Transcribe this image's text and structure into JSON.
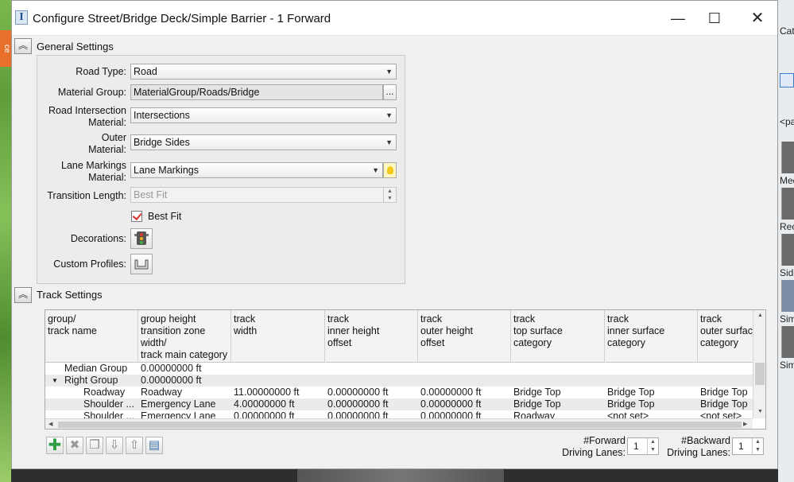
{
  "window": {
    "title": "Configure Street/Bridge Deck/Simple Barrier - 1 Forward",
    "app_icon_glyph": "I",
    "minimize_glyph": "—",
    "maximize_glyph": "☐",
    "close_glyph": "✕"
  },
  "background": {
    "right_fragments": [
      "Cata",
      "<pa",
      "Med",
      "Rec",
      "Side",
      "Sim",
      "Sim"
    ],
    "left_fragment": "ce"
  },
  "general_settings": {
    "label": "General Settings",
    "road_type": {
      "label": "Road Type:",
      "value": "Road"
    },
    "material_group": {
      "label": "Material Group:",
      "value": "MaterialGroup/Roads/Bridge",
      "browse_label": "..."
    },
    "road_intersection": {
      "label_line1": "Road Intersection",
      "label_line2": "Material:",
      "value": "Intersections"
    },
    "outer_material": {
      "label_line1": "Outer",
      "label_line2": "Material:",
      "value": "Bridge Sides"
    },
    "lane_markings": {
      "label_line1": "Lane Markings",
      "label_line2": "Material:",
      "value": "Lane Markings"
    },
    "transition_length": {
      "label": "Transition Length:",
      "value": "Best Fit"
    },
    "best_fit": {
      "label": "Best Fit",
      "checked": true
    },
    "decorations": {
      "label": "Decorations:",
      "icon": "traffic-light-icon"
    },
    "custom_profiles": {
      "label": "Custom Profiles:",
      "icon": "profile-shape-icon"
    }
  },
  "track_settings": {
    "label": "Track Settings",
    "columns": [
      "group/\ntrack name",
      "group height\ntransition zone\nwidth/\ntrack main category",
      "track\nwidth",
      "track\ninner height\noffset",
      "track\nouter height\noffset",
      "track\ntop surface\ncategory",
      "track\ninner surface\ncategory",
      "track\nouter surfac\ncategory"
    ],
    "rows": [
      {
        "expander": "",
        "cells": [
          "Median Group",
          "0.00000000 ft",
          "",
          "",
          "",
          "",
          "",
          ""
        ]
      },
      {
        "expander": "▼",
        "cells": [
          "Right Group",
          "0.00000000 ft",
          "",
          "",
          "",
          "",
          "",
          ""
        ]
      },
      {
        "expander": "",
        "cells": [
          "Roadway",
          "Roadway",
          "11.00000000 ft",
          "0.00000000 ft",
          "0.00000000 ft",
          "Bridge Top",
          "Bridge Top",
          "Bridge Top"
        ]
      },
      {
        "expander": "",
        "cells": [
          "Shoulder ...",
          "Emergency Lane",
          "4.00000000 ft",
          "0.00000000 ft",
          "0.00000000 ft",
          "Bridge Top",
          "Bridge Top",
          "Bridge Top"
        ]
      },
      {
        "expander": "",
        "cells": [
          "Shoulder ...",
          "Emergency Lane",
          "0.00000000 ft",
          "0.00000000 ft",
          "0.00000000 ft",
          "Roadway",
          "<not set>",
          "<not set>"
        ]
      }
    ],
    "toolbar": {
      "add": "add-icon",
      "remove": "remove-icon",
      "copy": "copy-icon",
      "move_down": "move-down-icon",
      "move_up": "move-up-icon",
      "edit": "edit-icon"
    },
    "forward_lanes": {
      "label_line1": "#Forward",
      "label_line2": "Driving Lanes:",
      "value": "1"
    },
    "backward_lanes": {
      "label_line1": "#Backward",
      "label_line2": "Driving Lanes:",
      "value": "1"
    }
  }
}
